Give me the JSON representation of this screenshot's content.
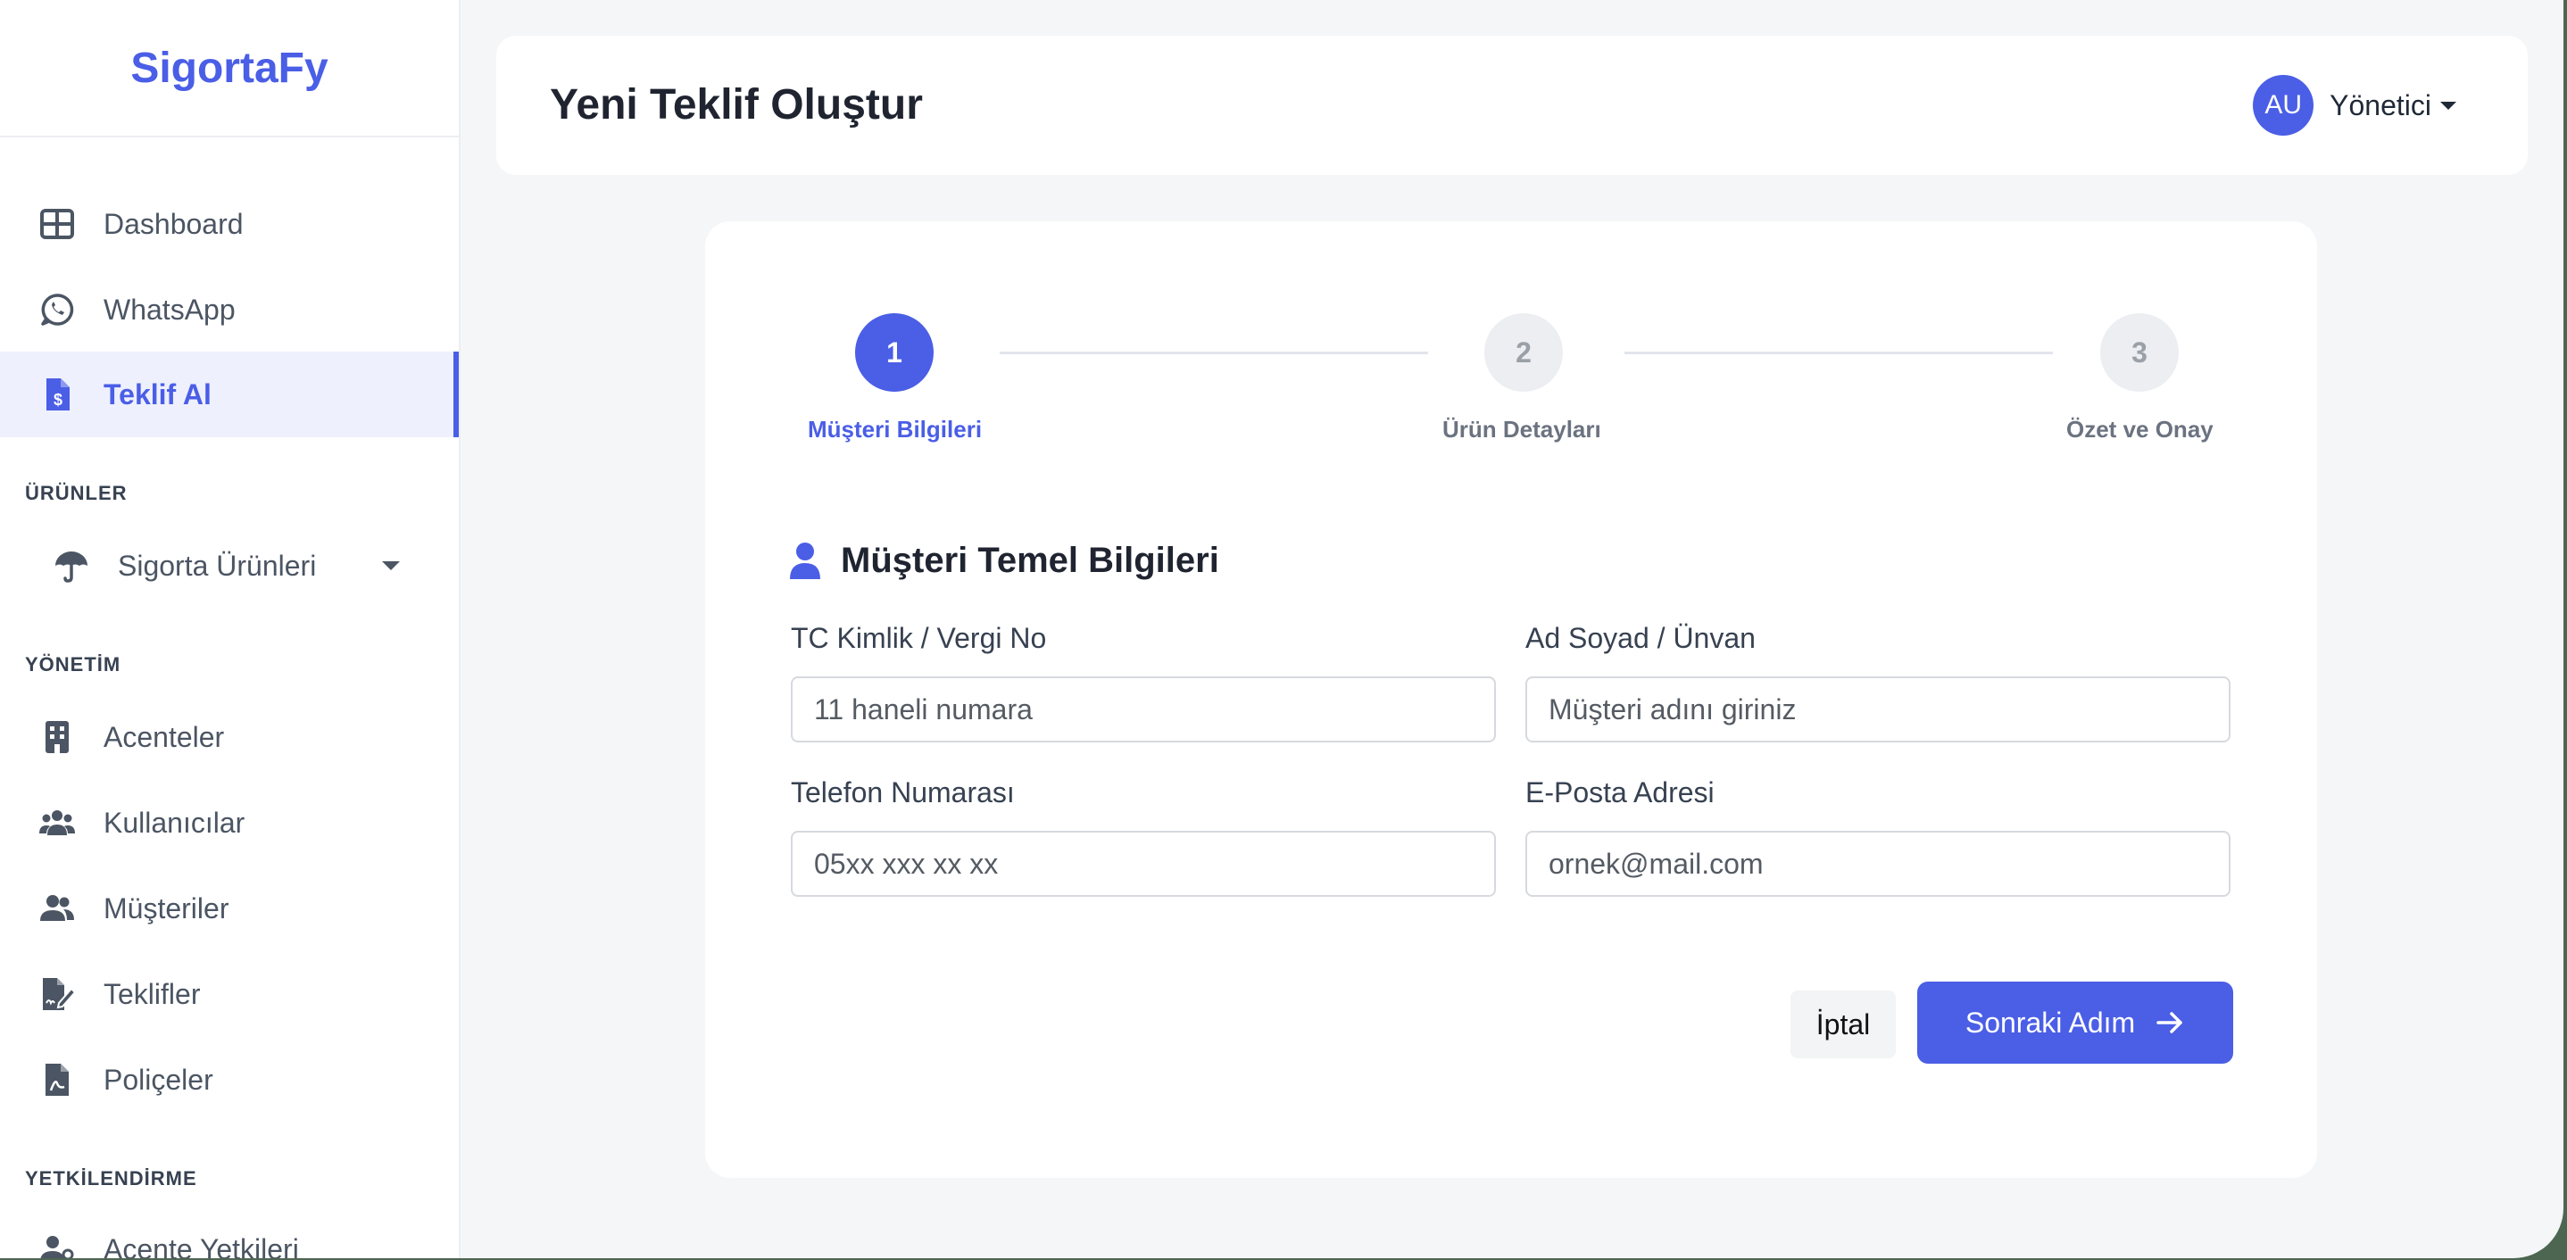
{
  "brand": "SigortaFy",
  "sidebar": {
    "main_items": [
      {
        "label": "Dashboard",
        "icon": "grid-icon"
      },
      {
        "label": "WhatsApp",
        "icon": "whatsapp-icon"
      },
      {
        "label": "Teklif Al",
        "icon": "file-dollar-icon",
        "active": true
      }
    ],
    "sections": {
      "products": "ÜRÜNLER",
      "management": "YÖNETİM",
      "authorization": "YETKİLENDİRME"
    },
    "products_dropdown": {
      "label": "Sigorta Ürünleri",
      "icon": "umbrella-icon"
    },
    "management_items": [
      {
        "label": "Acenteler",
        "icon": "building-icon"
      },
      {
        "label": "Kullanıcılar",
        "icon": "users-icon"
      },
      {
        "label": "Müşteriler",
        "icon": "user-group-icon"
      },
      {
        "label": "Teklifler",
        "icon": "file-signature-icon"
      },
      {
        "label": "Poliçeler",
        "icon": "file-pdf-icon"
      }
    ],
    "authorization_items": [
      {
        "label": "Acente Yetkileri",
        "icon": "user-key-icon"
      }
    ]
  },
  "header": {
    "title": "Yeni Teklif Oluştur",
    "avatar_initials": "AU",
    "user_name": "Yönetici"
  },
  "stepper": {
    "steps": [
      {
        "number": "1",
        "label": "Müşteri Bilgileri",
        "active": true
      },
      {
        "number": "2",
        "label": "Ürün Detayları",
        "active": false
      },
      {
        "number": "3",
        "label": "Özet ve Onay",
        "active": false
      }
    ]
  },
  "form": {
    "section_title": "Müşteri Temel Bilgileri",
    "fields": {
      "tc": {
        "label": "TC Kimlik / Vergi No",
        "placeholder": "11 haneli numara"
      },
      "name": {
        "label": "Ad Soyad / Ünvan",
        "placeholder": "Müşteri adını giriniz"
      },
      "phone": {
        "label": "Telefon Numarası",
        "placeholder": "05xx xxx xx xx"
      },
      "email": {
        "label": "E-Posta Adresi",
        "placeholder": "ornek@mail.com"
      }
    },
    "cancel_label": "İptal",
    "next_label": "Sonraki Adım"
  },
  "colors": {
    "accent": "#4a5ee6",
    "background": "#f5f6f8"
  }
}
